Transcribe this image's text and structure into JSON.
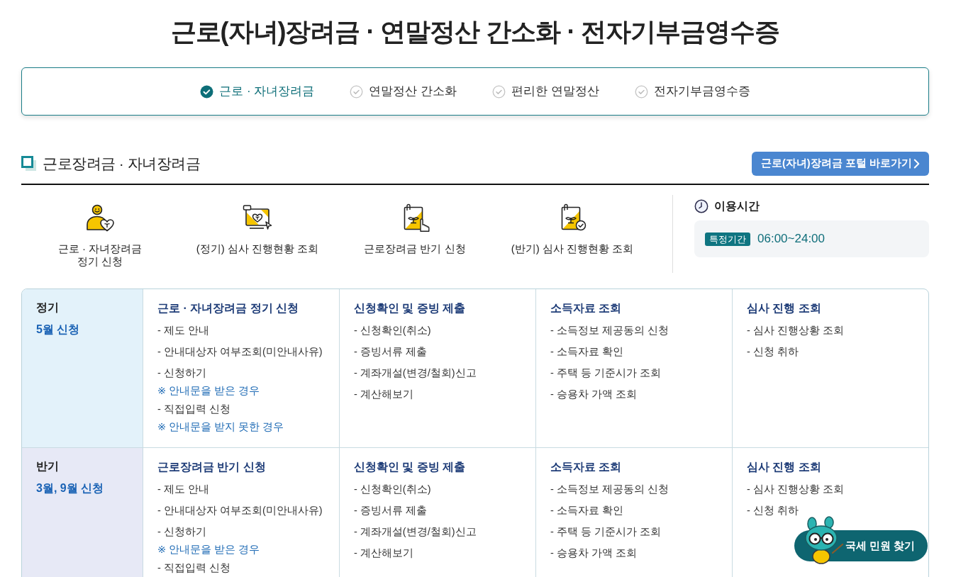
{
  "page_title": "근로(자녀)장려금 · 연말정산 간소화 · 전자기부금영수증",
  "tabs": [
    {
      "label": "근로 · 자녀장려금",
      "selected": true
    },
    {
      "label": "연말정산 간소화",
      "selected": false
    },
    {
      "label": "편리한 연말정산",
      "selected": false
    },
    {
      "label": "전자기부금영수증",
      "selected": false
    }
  ],
  "section": {
    "title": "근로장려금 · 자녀장려금",
    "portal_button": "근로(자녀)장려금 포털 바로가기"
  },
  "quick_services": [
    {
      "kind": "person",
      "label": "근로 · 자녀장려금\n정기 신청"
    },
    {
      "kind": "monitor",
      "label": "(정기) 심사 진행현황 조회"
    },
    {
      "kind": "document_hand",
      "label": "근로장려금 반기 신청"
    },
    {
      "kind": "document_check",
      "label": "(반기) 심사 진행현황 조회"
    }
  ],
  "usage_time": {
    "title": "이용시간",
    "badge": "특정기간",
    "hours": "06:00~24:00"
  },
  "schedule": [
    {
      "label": "정기",
      "period": "5월 신청",
      "color": "#e3f2fa",
      "columns": [
        {
          "title": "근로 · 자녀장려금 정기 신청",
          "items": [
            {
              "kind": "link",
              "text": "- 제도 안내"
            },
            {
              "kind": "link",
              "text": "- 안내대상자 여부조회(미안내사유)"
            },
            {
              "kind": "link",
              "text": "- 신청하기"
            },
            {
              "kind": "note",
              "text": "※ 안내문을 받은 경우"
            },
            {
              "kind": "link",
              "text": "- 직접입력 신청"
            },
            {
              "kind": "note",
              "text": "※ 안내문을 받지 못한 경우"
            }
          ]
        },
        {
          "title": "신청확인 및 증빙 제출",
          "items": [
            {
              "kind": "link",
              "text": "- 신청확인(취소)"
            },
            {
              "kind": "link",
              "text": "- 증빙서류 제출"
            },
            {
              "kind": "link",
              "text": "- 계좌개설(변경/철회)신고"
            },
            {
              "kind": "link",
              "text": "- 계산해보기"
            }
          ]
        },
        {
          "title": "소득자료 조회",
          "items": [
            {
              "kind": "link",
              "text": "- 소득정보 제공동의 신청"
            },
            {
              "kind": "link",
              "text": "- 소득자료 확인"
            },
            {
              "kind": "link",
              "text": "- 주택 등 기준시가 조회"
            },
            {
              "kind": "link",
              "text": "- 승용차 가액 조회"
            }
          ]
        },
        {
          "title": "심사 진행 조회",
          "items": [
            {
              "kind": "link",
              "text": "- 심사 진행상황 조회"
            },
            {
              "kind": "link",
              "text": "- 신청 취하"
            }
          ]
        }
      ]
    },
    {
      "label": "반기",
      "period": "3월, 9월 신청",
      "color": "#e7e9f6",
      "columns": [
        {
          "title": "근로장려금 반기 신청",
          "items": [
            {
              "kind": "link",
              "text": "- 제도 안내"
            },
            {
              "kind": "link",
              "text": "- 안내대상자 여부조회(미안내사유)"
            },
            {
              "kind": "link",
              "text": "- 신청하기"
            },
            {
              "kind": "note",
              "text": "※ 안내문을 받은 경우"
            },
            {
              "kind": "link",
              "text": "- 직접입력 신청"
            }
          ]
        },
        {
          "title": "신청확인 및 증빙 제출",
          "items": [
            {
              "kind": "link",
              "text": "- 신청확인(취소)"
            },
            {
              "kind": "link",
              "text": "- 증빙서류 제출"
            },
            {
              "kind": "link",
              "text": "- 계좌개설(변경/철회)신고"
            },
            {
              "kind": "link",
              "text": "- 계산해보기"
            }
          ]
        },
        {
          "title": "소득자료 조회",
          "items": [
            {
              "kind": "link",
              "text": "- 소득정보 제공동의 신청"
            },
            {
              "kind": "link",
              "text": "- 소득자료 확인"
            },
            {
              "kind": "link",
              "text": "- 주택 등 기준시가 조회"
            },
            {
              "kind": "link",
              "text": "- 승용차 가액 조회"
            }
          ]
        },
        {
          "title": "심사 진행 조회",
          "items": [
            {
              "kind": "link",
              "text": "- 심사 진행상황 조회"
            },
            {
              "kind": "link",
              "text": "- 신청 취하"
            }
          ]
        }
      ]
    }
  ],
  "help_button": {
    "label": "국세 민원 찾기"
  }
}
